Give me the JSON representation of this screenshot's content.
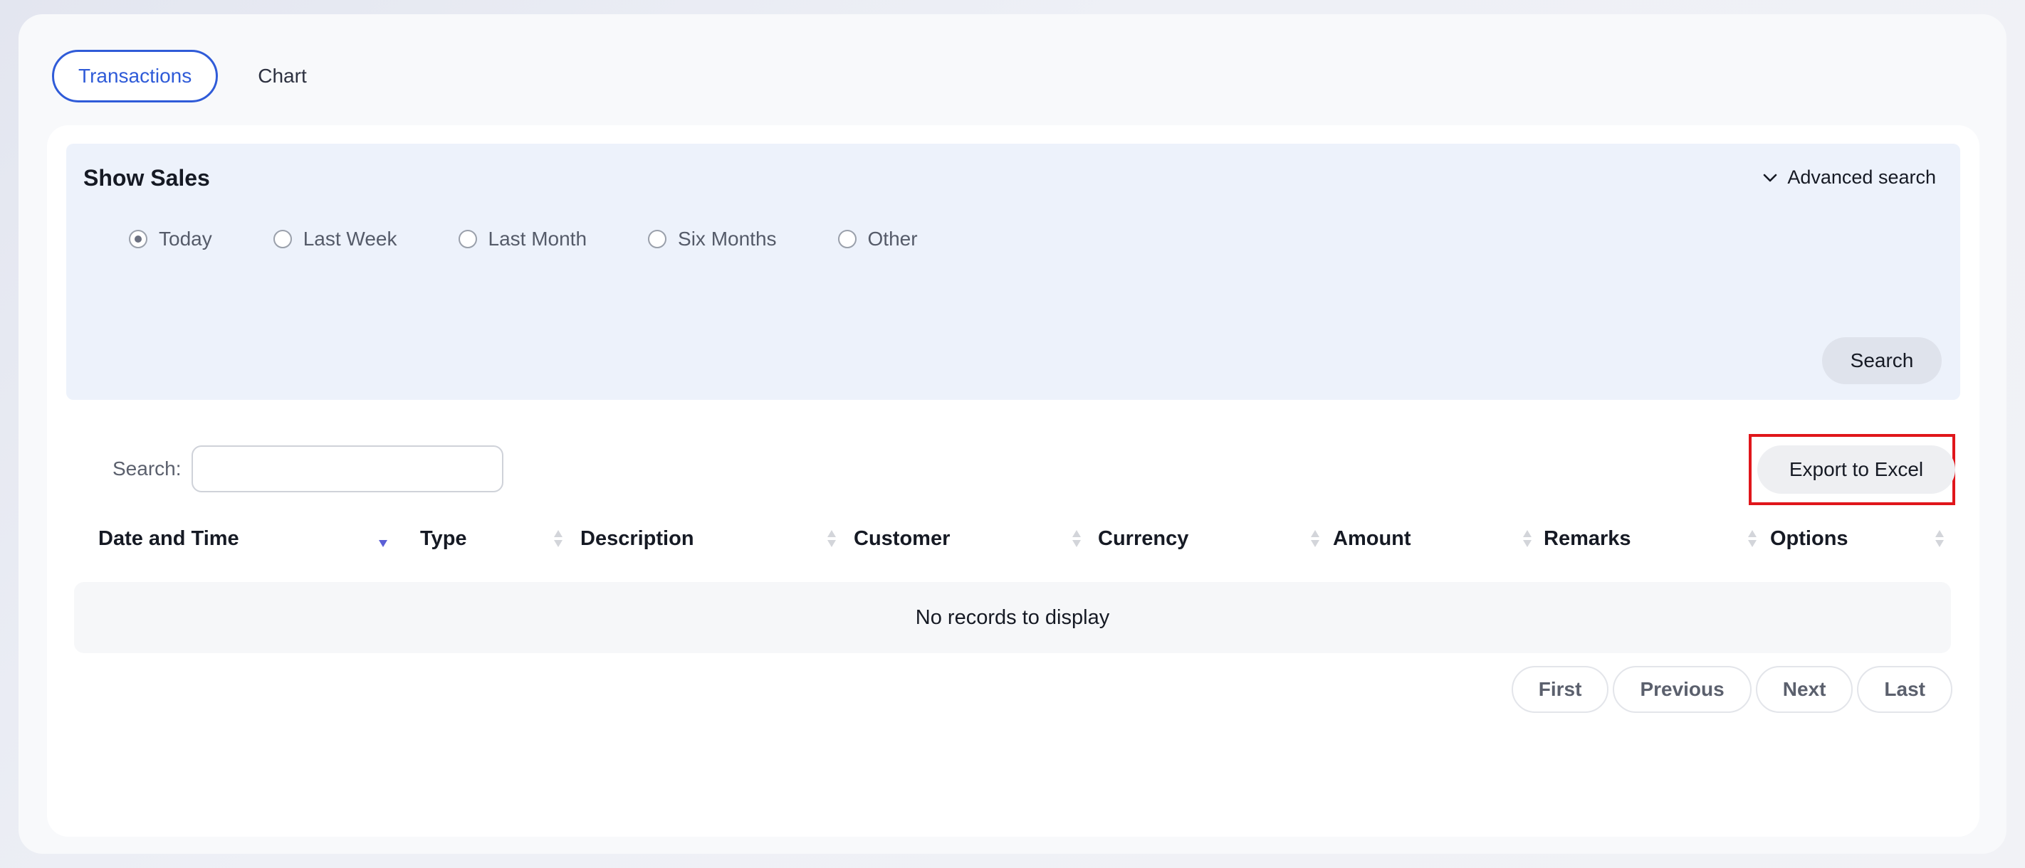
{
  "tabs": [
    {
      "label": "Transactions",
      "active": true
    },
    {
      "label": "Chart",
      "active": false
    }
  ],
  "filter": {
    "title": "Show Sales",
    "advanced_search_label": "Advanced search",
    "options": [
      {
        "label": "Today",
        "checked": true
      },
      {
        "label": "Last Week",
        "checked": false
      },
      {
        "label": "Last Month",
        "checked": false
      },
      {
        "label": "Six Months",
        "checked": false
      },
      {
        "label": "Other",
        "checked": false
      }
    ],
    "search_button_label": "Search"
  },
  "table": {
    "search_label": "Search:",
    "search_value": "",
    "export_label": "Export to Excel",
    "columns": [
      {
        "label": "Date and Time",
        "sort": "desc"
      },
      {
        "label": "Type",
        "sort": "none"
      },
      {
        "label": "Description",
        "sort": "none"
      },
      {
        "label": "Customer",
        "sort": "none"
      },
      {
        "label": "Currency",
        "sort": "none"
      },
      {
        "label": "Amount",
        "sort": "none"
      },
      {
        "label": "Remarks",
        "sort": "none"
      },
      {
        "label": "Options",
        "sort": "none"
      }
    ],
    "empty_message": "No records to display"
  },
  "pagination": {
    "first": "First",
    "previous": "Previous",
    "next": "Next",
    "last": "Last"
  },
  "colors": {
    "accent": "#2f5bd8",
    "highlight": "#e0161b",
    "filter_background": "#edf2fb",
    "sort_active": "#5b5fd6"
  }
}
